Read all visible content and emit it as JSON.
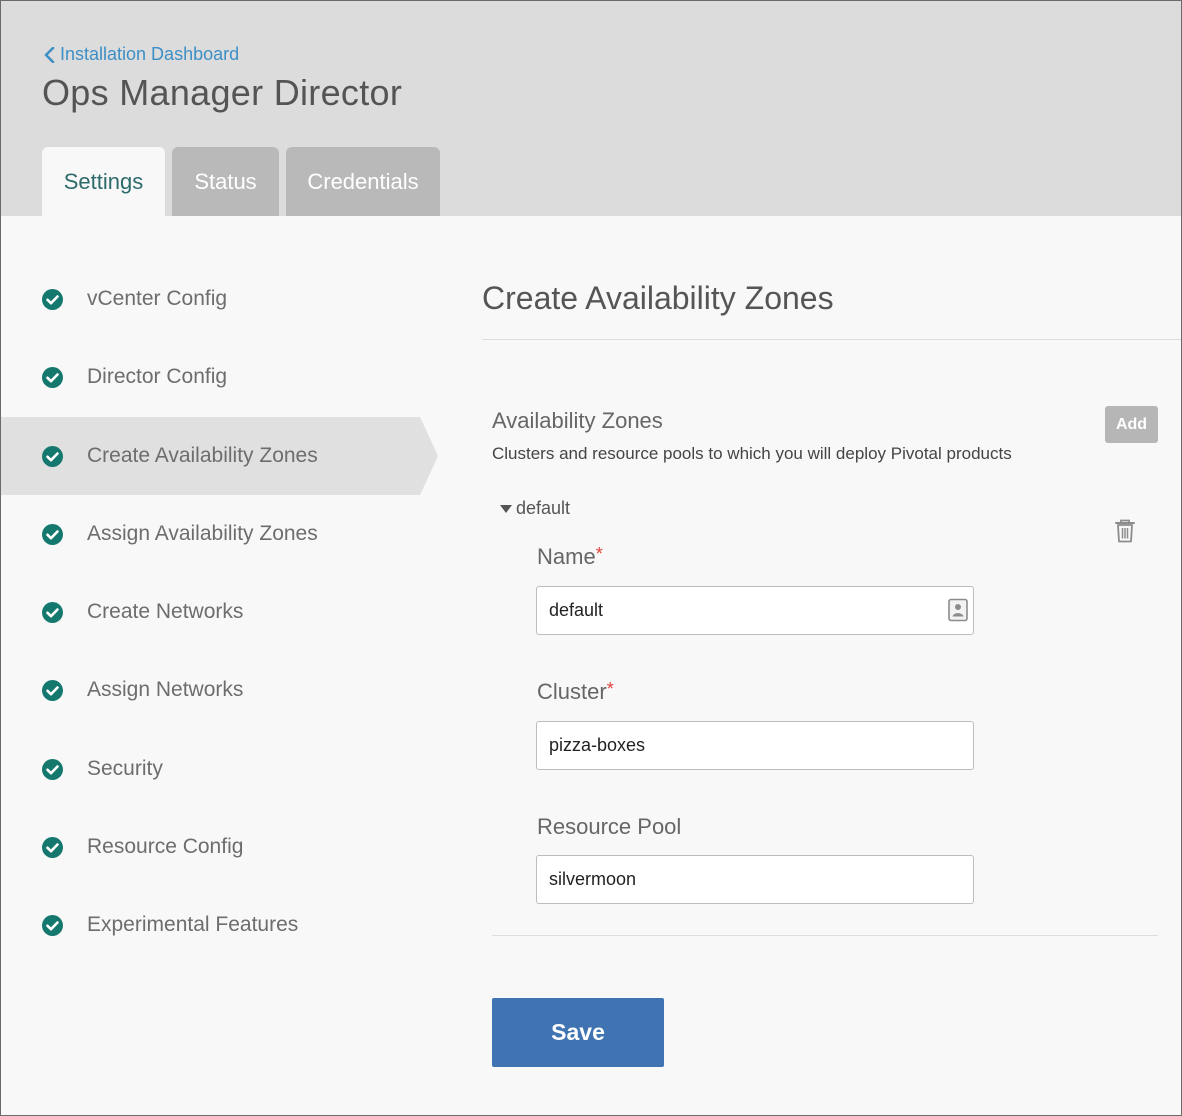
{
  "header": {
    "back_link": "Installation Dashboard",
    "title": "Ops Manager Director",
    "tabs": [
      {
        "label": "Settings",
        "active": true
      },
      {
        "label": "Status",
        "active": false
      },
      {
        "label": "Credentials",
        "active": false
      }
    ]
  },
  "sidebar": {
    "items": [
      {
        "label": "vCenter Config",
        "complete": true,
        "active": false
      },
      {
        "label": "Director Config",
        "complete": true,
        "active": false
      },
      {
        "label": "Create Availability Zones",
        "complete": true,
        "active": true
      },
      {
        "label": "Assign Availability Zones",
        "complete": true,
        "active": false
      },
      {
        "label": "Create Networks",
        "complete": true,
        "active": false
      },
      {
        "label": "Assign Networks",
        "complete": true,
        "active": false
      },
      {
        "label": "Security",
        "complete": true,
        "active": false
      },
      {
        "label": "Resource Config",
        "complete": true,
        "active": false
      },
      {
        "label": "Experimental Features",
        "complete": true,
        "active": false
      }
    ]
  },
  "main": {
    "title": "Create Availability Zones",
    "section_title": "Availability Zones",
    "section_desc": "Clusters and resource pools to which you will deploy Pivotal products",
    "add_label": "Add",
    "zone": {
      "name": "default",
      "fields": {
        "name_label": "Name",
        "name_value": "default",
        "cluster_label": "Cluster",
        "cluster_value": "pizza-boxes",
        "pool_label": "Resource Pool",
        "pool_value": "silvermoon",
        "required_mark": "*"
      }
    },
    "save_label": "Save"
  },
  "colors": {
    "accent": "#3f73b2",
    "link": "#3d8fc6",
    "check": "#14786e",
    "required": "#e0423a",
    "header_bg": "#dcdcdc"
  },
  "icons": {
    "back": "chevron-left-icon",
    "check": "check-circle-icon",
    "toggle": "caret-down-icon",
    "delete": "trash-icon",
    "autofill": "contact-card-icon"
  }
}
